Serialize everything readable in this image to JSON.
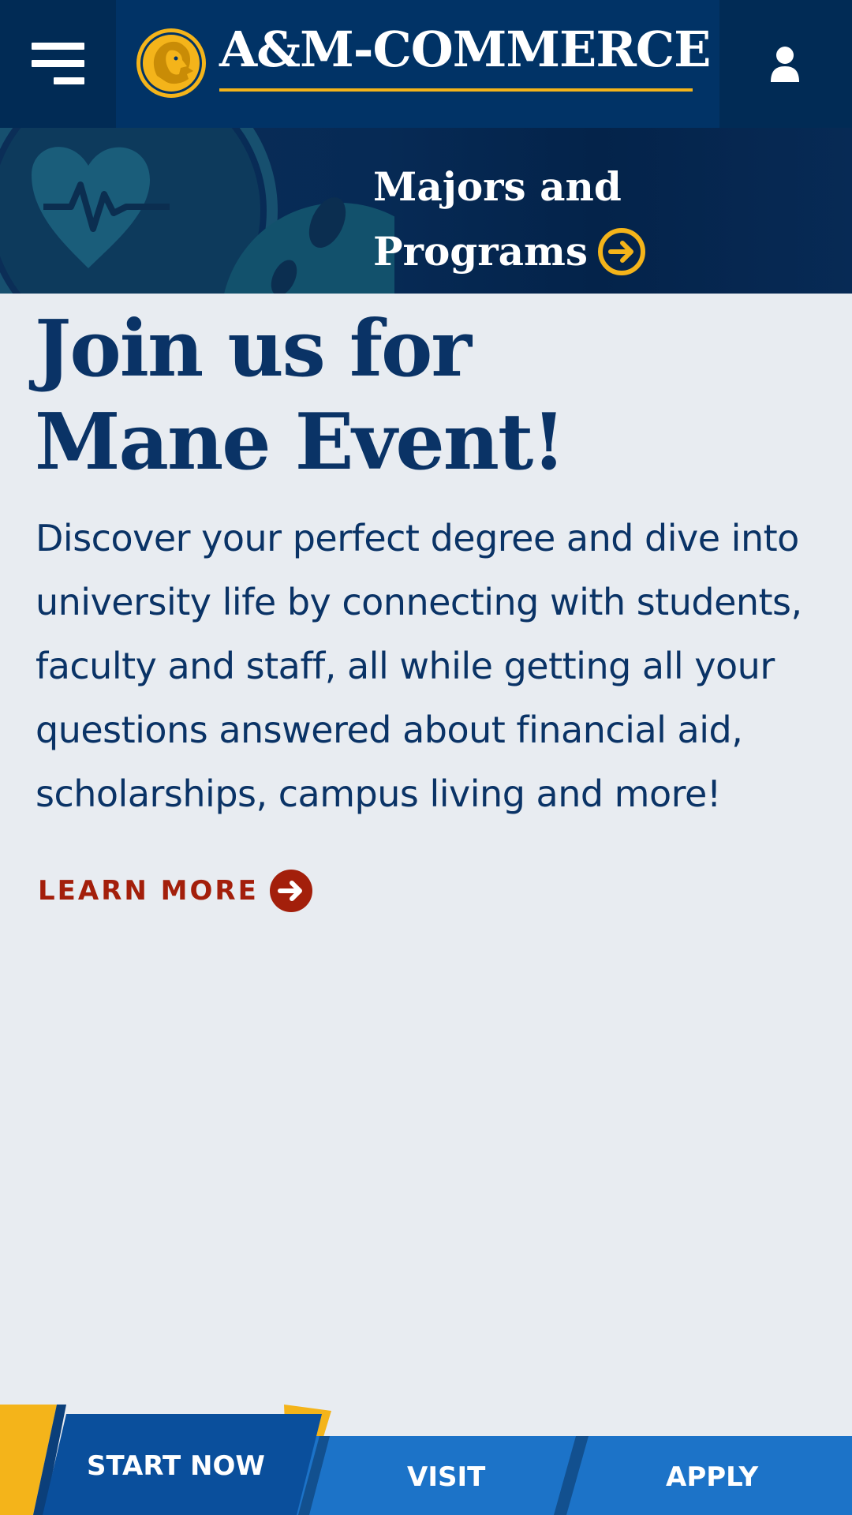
{
  "header": {
    "menu_icon": "hamburger-menu-icon",
    "logo_text": "A&M-COMMERCE",
    "logo_icon": "lion-head-icon",
    "user_icon": "user-account-icon",
    "colors": {
      "navy": "#002a55",
      "logo_bg": "#013366",
      "gold": "#f4b41a"
    }
  },
  "majors_banner": {
    "line1": "Majors and",
    "line2": "Programs",
    "arrow_icon": "arrow-right-circle-icon"
  },
  "main": {
    "headline_line1": "Join us for",
    "headline_line2": "Mane Event!",
    "description": "Discover your perfect degree and dive into university life by connecting with students, faculty and staff, all while getting all your questions answered about financial aid, scholarships, campus living and more!",
    "learn_more_label": "LEARN MORE",
    "learn_more_icon": "arrow-right-circle-icon",
    "colors": {
      "text": "#0a3366",
      "accent": "#a31f0b"
    }
  },
  "cta_bar": {
    "start_now": "START NOW",
    "visit": "VISIT",
    "apply": "APPLY",
    "colors": {
      "start": "#0a4f9c",
      "visit": "#1c73c8",
      "apply": "#1f75cc",
      "gold": "#f4b41a"
    }
  }
}
